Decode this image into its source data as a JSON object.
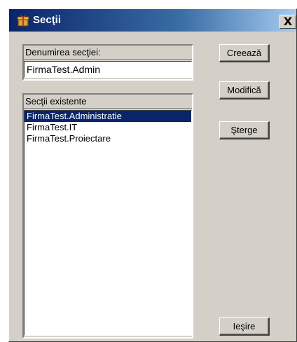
{
  "window": {
    "title": "Secţii",
    "close_label": "X"
  },
  "form": {
    "name_label": "Denumirea secţiei:",
    "name_value": "FirmaTest.Admin",
    "list_label": "Secţii existente",
    "list_items": [
      {
        "label": "FirmaTest.Administratie",
        "selected": true
      },
      {
        "label": "FirmaTest.IT",
        "selected": false
      },
      {
        "label": "FirmaTest.Proiectare",
        "selected": false
      }
    ]
  },
  "buttons": {
    "create": "Creează",
    "modify": "Modifică",
    "delete": "Şterge",
    "exit": "Ieşire"
  },
  "colors": {
    "selection": "#0a246a",
    "face": "#d4d0c8"
  },
  "icons": {
    "title_icon": "app-gift-icon"
  }
}
